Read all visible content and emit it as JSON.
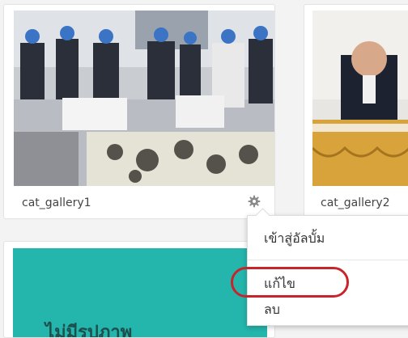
{
  "gallery": {
    "items": [
      {
        "caption": "cat_gallery1",
        "settings_icon": "gear-icon"
      },
      {
        "caption": "cat_gallery2"
      }
    ],
    "teal_card_text": "ไม่มีรูปภาพ"
  },
  "context_menu": {
    "items": [
      {
        "label": "เข้าสู่อัลบั้ม"
      },
      {
        "label": "แก้ไข"
      },
      {
        "label": "ลบ"
      }
    ]
  },
  "colors": {
    "teal": "#24b5ac",
    "highlight": "#c8242b"
  }
}
